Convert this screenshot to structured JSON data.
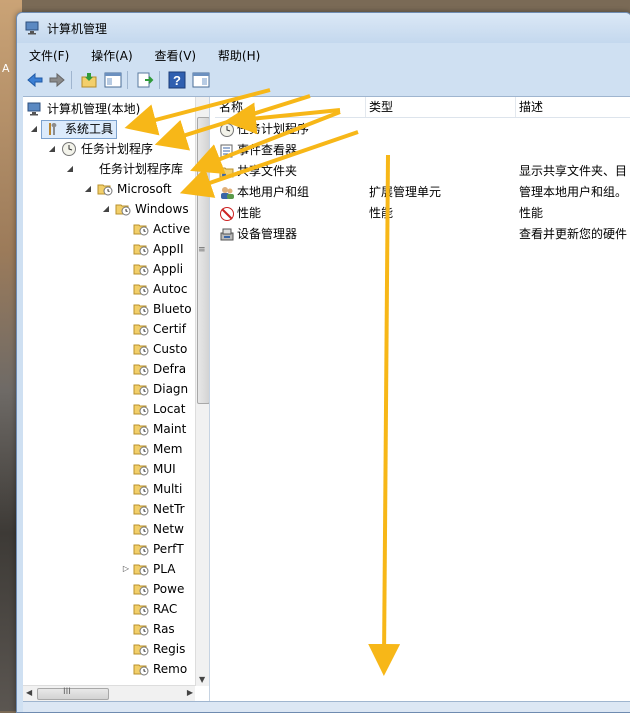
{
  "desktop": {
    "left_text": "A"
  },
  "window": {
    "title": "计算机管理",
    "title_icon": "computer-management-icon"
  },
  "menu": [
    {
      "label": "文件(F)"
    },
    {
      "label": "操作(A)"
    },
    {
      "label": "查看(V)"
    },
    {
      "label": "帮助(H)"
    }
  ],
  "toolbar": {
    "buttons": [
      "back-icon",
      "forward-icon",
      "up-folder-icon",
      "show-tree-icon",
      "export-icon",
      "help-icon",
      "properties-icon"
    ]
  },
  "tree": {
    "items": [
      {
        "label": "计算机管理(本地)",
        "icon": "computer-icon"
      },
      {
        "label": "系统工具",
        "icon": "tools-icon"
      },
      {
        "label": "任务计划程序",
        "icon": "clock-icon"
      },
      {
        "label": "任务计划程序库",
        "icon": ""
      },
      {
        "label": "Microsoft",
        "icon": "folder-clock-icon"
      },
      {
        "label": "Windows",
        "icon": "folder-clock-icon"
      },
      {
        "label": "Active",
        "icon": "folder-clock-icon"
      },
      {
        "label": "AppII",
        "icon": "folder-clock-icon"
      },
      {
        "label": "Appli",
        "icon": "folder-clock-icon"
      },
      {
        "label": "Autoc",
        "icon": "folder-clock-icon"
      },
      {
        "label": "Blueto",
        "icon": "folder-clock-icon"
      },
      {
        "label": "Certif",
        "icon": "folder-clock-icon"
      },
      {
        "label": "Custo",
        "icon": "folder-clock-icon"
      },
      {
        "label": "Defra",
        "icon": "folder-clock-icon"
      },
      {
        "label": "Diagn",
        "icon": "folder-clock-icon"
      },
      {
        "label": "Locat",
        "icon": "folder-clock-icon"
      },
      {
        "label": "Maint",
        "icon": "folder-clock-icon"
      },
      {
        "label": "Mem",
        "icon": "folder-clock-icon"
      },
      {
        "label": "MUI",
        "icon": "folder-clock-icon"
      },
      {
        "label": "Multi",
        "icon": "folder-clock-icon"
      },
      {
        "label": "NetTr",
        "icon": "folder-clock-icon"
      },
      {
        "label": "Netw",
        "icon": "folder-clock-icon"
      },
      {
        "label": "PerfT",
        "icon": "folder-clock-icon"
      },
      {
        "label": "PLA",
        "icon": "folder-clock-icon"
      },
      {
        "label": "Powe",
        "icon": "folder-clock-icon"
      },
      {
        "label": "RAC",
        "icon": "folder-clock-icon"
      },
      {
        "label": "Ras",
        "icon": "folder-clock-icon"
      },
      {
        "label": "Regis",
        "icon": "folder-clock-icon"
      },
      {
        "label": "Remo",
        "icon": "folder-clock-icon"
      }
    ]
  },
  "list": {
    "columns": [
      "名称",
      "类型",
      "描述"
    ],
    "rows": [
      {
        "name": "任务计划程序",
        "type": "",
        "desc": "",
        "icon": "clock-icon"
      },
      {
        "name": "事件查看器",
        "type": "",
        "desc": "",
        "icon": "event-viewer-icon"
      },
      {
        "name": "共享文件夹",
        "type": "",
        "desc": "显示共享文件夹、目",
        "icon": "shared-folder-icon"
      },
      {
        "name": "本地用户和组",
        "type": "扩展管理单元",
        "desc": "管理本地用户和组。",
        "icon": "users-icon"
      },
      {
        "name": "性能",
        "type": "性能",
        "desc": "性能",
        "icon": "performance-icon"
      },
      {
        "name": "设备管理器",
        "type": "",
        "desc": "查看并更新您的硬件",
        "icon": "device-manager-icon"
      }
    ]
  },
  "colors": {
    "annotation_arrow": "#f7b718",
    "selection_border": "#7da2ce",
    "window_frame": "#cfe0f2"
  }
}
